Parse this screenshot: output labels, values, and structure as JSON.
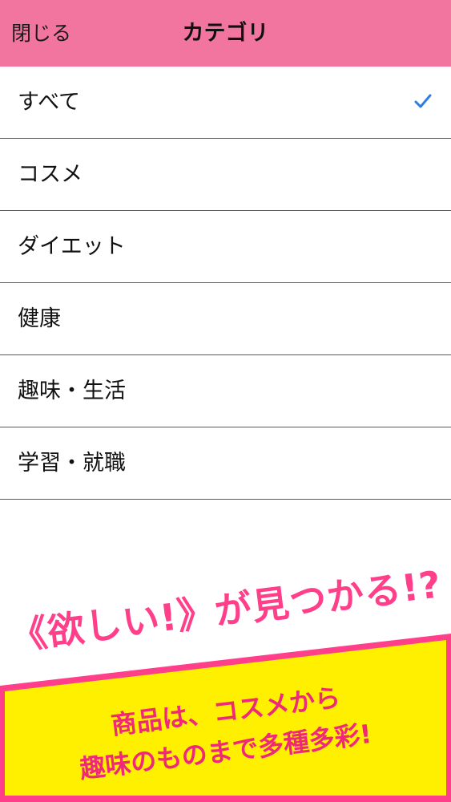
{
  "header": {
    "close_label": "閉じる",
    "title": "カテゴリ"
  },
  "categories": [
    {
      "label": "すべて",
      "selected": true
    },
    {
      "label": "コスメ",
      "selected": false
    },
    {
      "label": "ダイエット",
      "selected": false
    },
    {
      "label": "健康",
      "selected": false
    },
    {
      "label": "趣味・生活",
      "selected": false
    },
    {
      "label": "学習・就職",
      "selected": false
    }
  ],
  "promo": {
    "headline": "《欲しい!》が見つかる!?",
    "sub_line1": "商品は、コスメから",
    "sub_line2": "趣味のものまで多種多彩!"
  },
  "colors": {
    "header_bg": "#f2759f",
    "check": "#2f7de1",
    "promo_pink": "#ff3f8a",
    "banner_yellow": "#fff000"
  }
}
